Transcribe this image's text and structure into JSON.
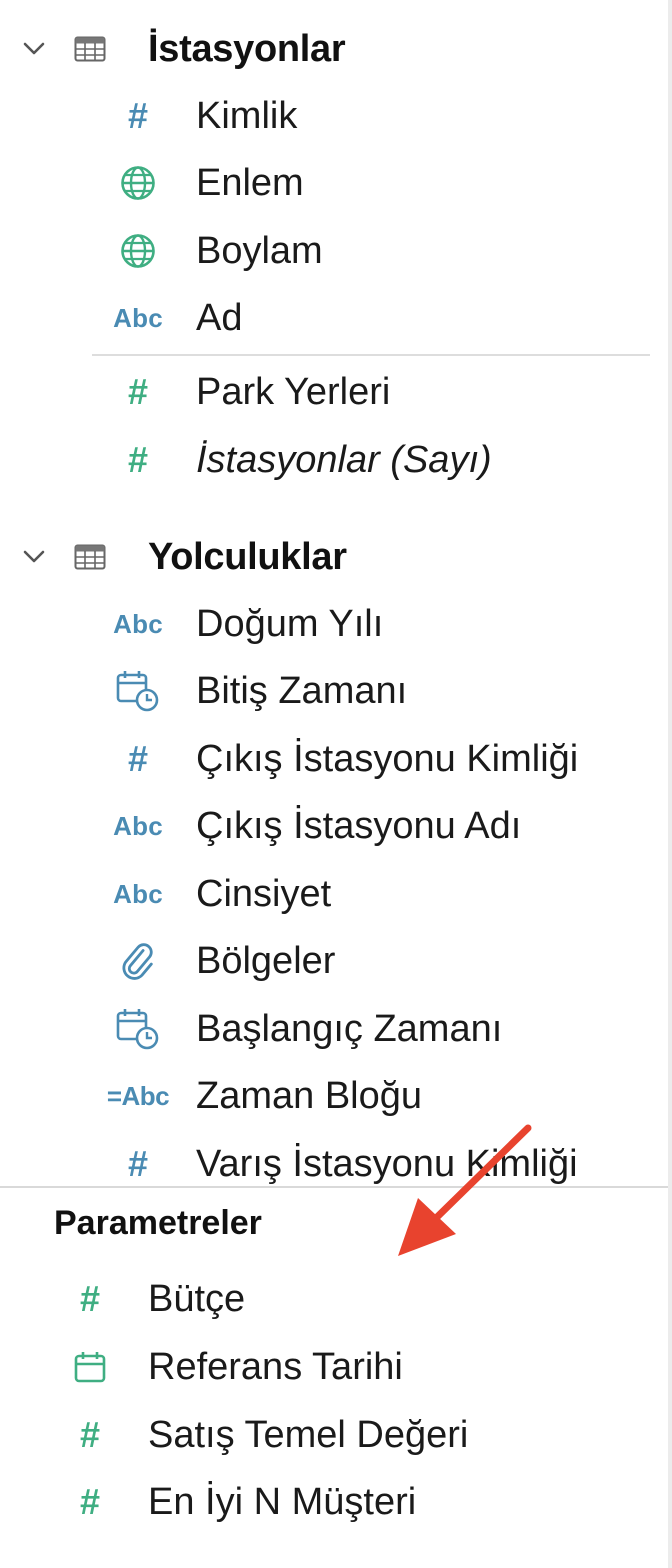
{
  "sections": [
    {
      "title": "İstasyonlar",
      "fields": [
        {
          "icon": "number-blue",
          "label": "Kimlik"
        },
        {
          "icon": "globe",
          "label": "Enlem"
        },
        {
          "icon": "globe",
          "label": "Boylam"
        },
        {
          "icon": "abc",
          "label": "Ad"
        }
      ],
      "measures": [
        {
          "icon": "number-green",
          "label": "Park Yerleri"
        },
        {
          "icon": "number-green",
          "label": "İstasyonlar (Sayı)"
        }
      ]
    },
    {
      "title": "Yolculuklar",
      "fields": [
        {
          "icon": "abc",
          "label": "Doğum Yılı"
        },
        {
          "icon": "datetime",
          "label": "Bitiş Zamanı"
        },
        {
          "icon": "number-blue",
          "label": "Çıkış İstasyonu Kimliği"
        },
        {
          "icon": "abc",
          "label": "Çıkış İstasyonu Adı"
        },
        {
          "icon": "abc",
          "label": "Cinsiyet"
        },
        {
          "icon": "paperclip",
          "label": "Bölgeler"
        },
        {
          "icon": "datetime",
          "label": "Başlangıç Zamanı"
        },
        {
          "icon": "calc-abc",
          "label": "Zaman Bloğu"
        },
        {
          "icon": "number-blue",
          "label": "Varış İstasyonu Kimliği"
        }
      ]
    }
  ],
  "parameters": {
    "title": "Parametreler",
    "items": [
      {
        "icon": "number-green",
        "label": "Bütçe"
      },
      {
        "icon": "calendar-green",
        "label": "Referans Tarihi"
      },
      {
        "icon": "number-green",
        "label": "Satış Temel Değeri"
      },
      {
        "icon": "number-green",
        "label": "En İyi N Müşteri"
      }
    ]
  },
  "icon_text": {
    "abc": "Abc",
    "calc_abc": "=Abc",
    "number": "#"
  },
  "colors": {
    "dimension_blue": "#4a8bb3",
    "measure_green": "#3fae82",
    "annotation_arrow": "#e8432e"
  }
}
